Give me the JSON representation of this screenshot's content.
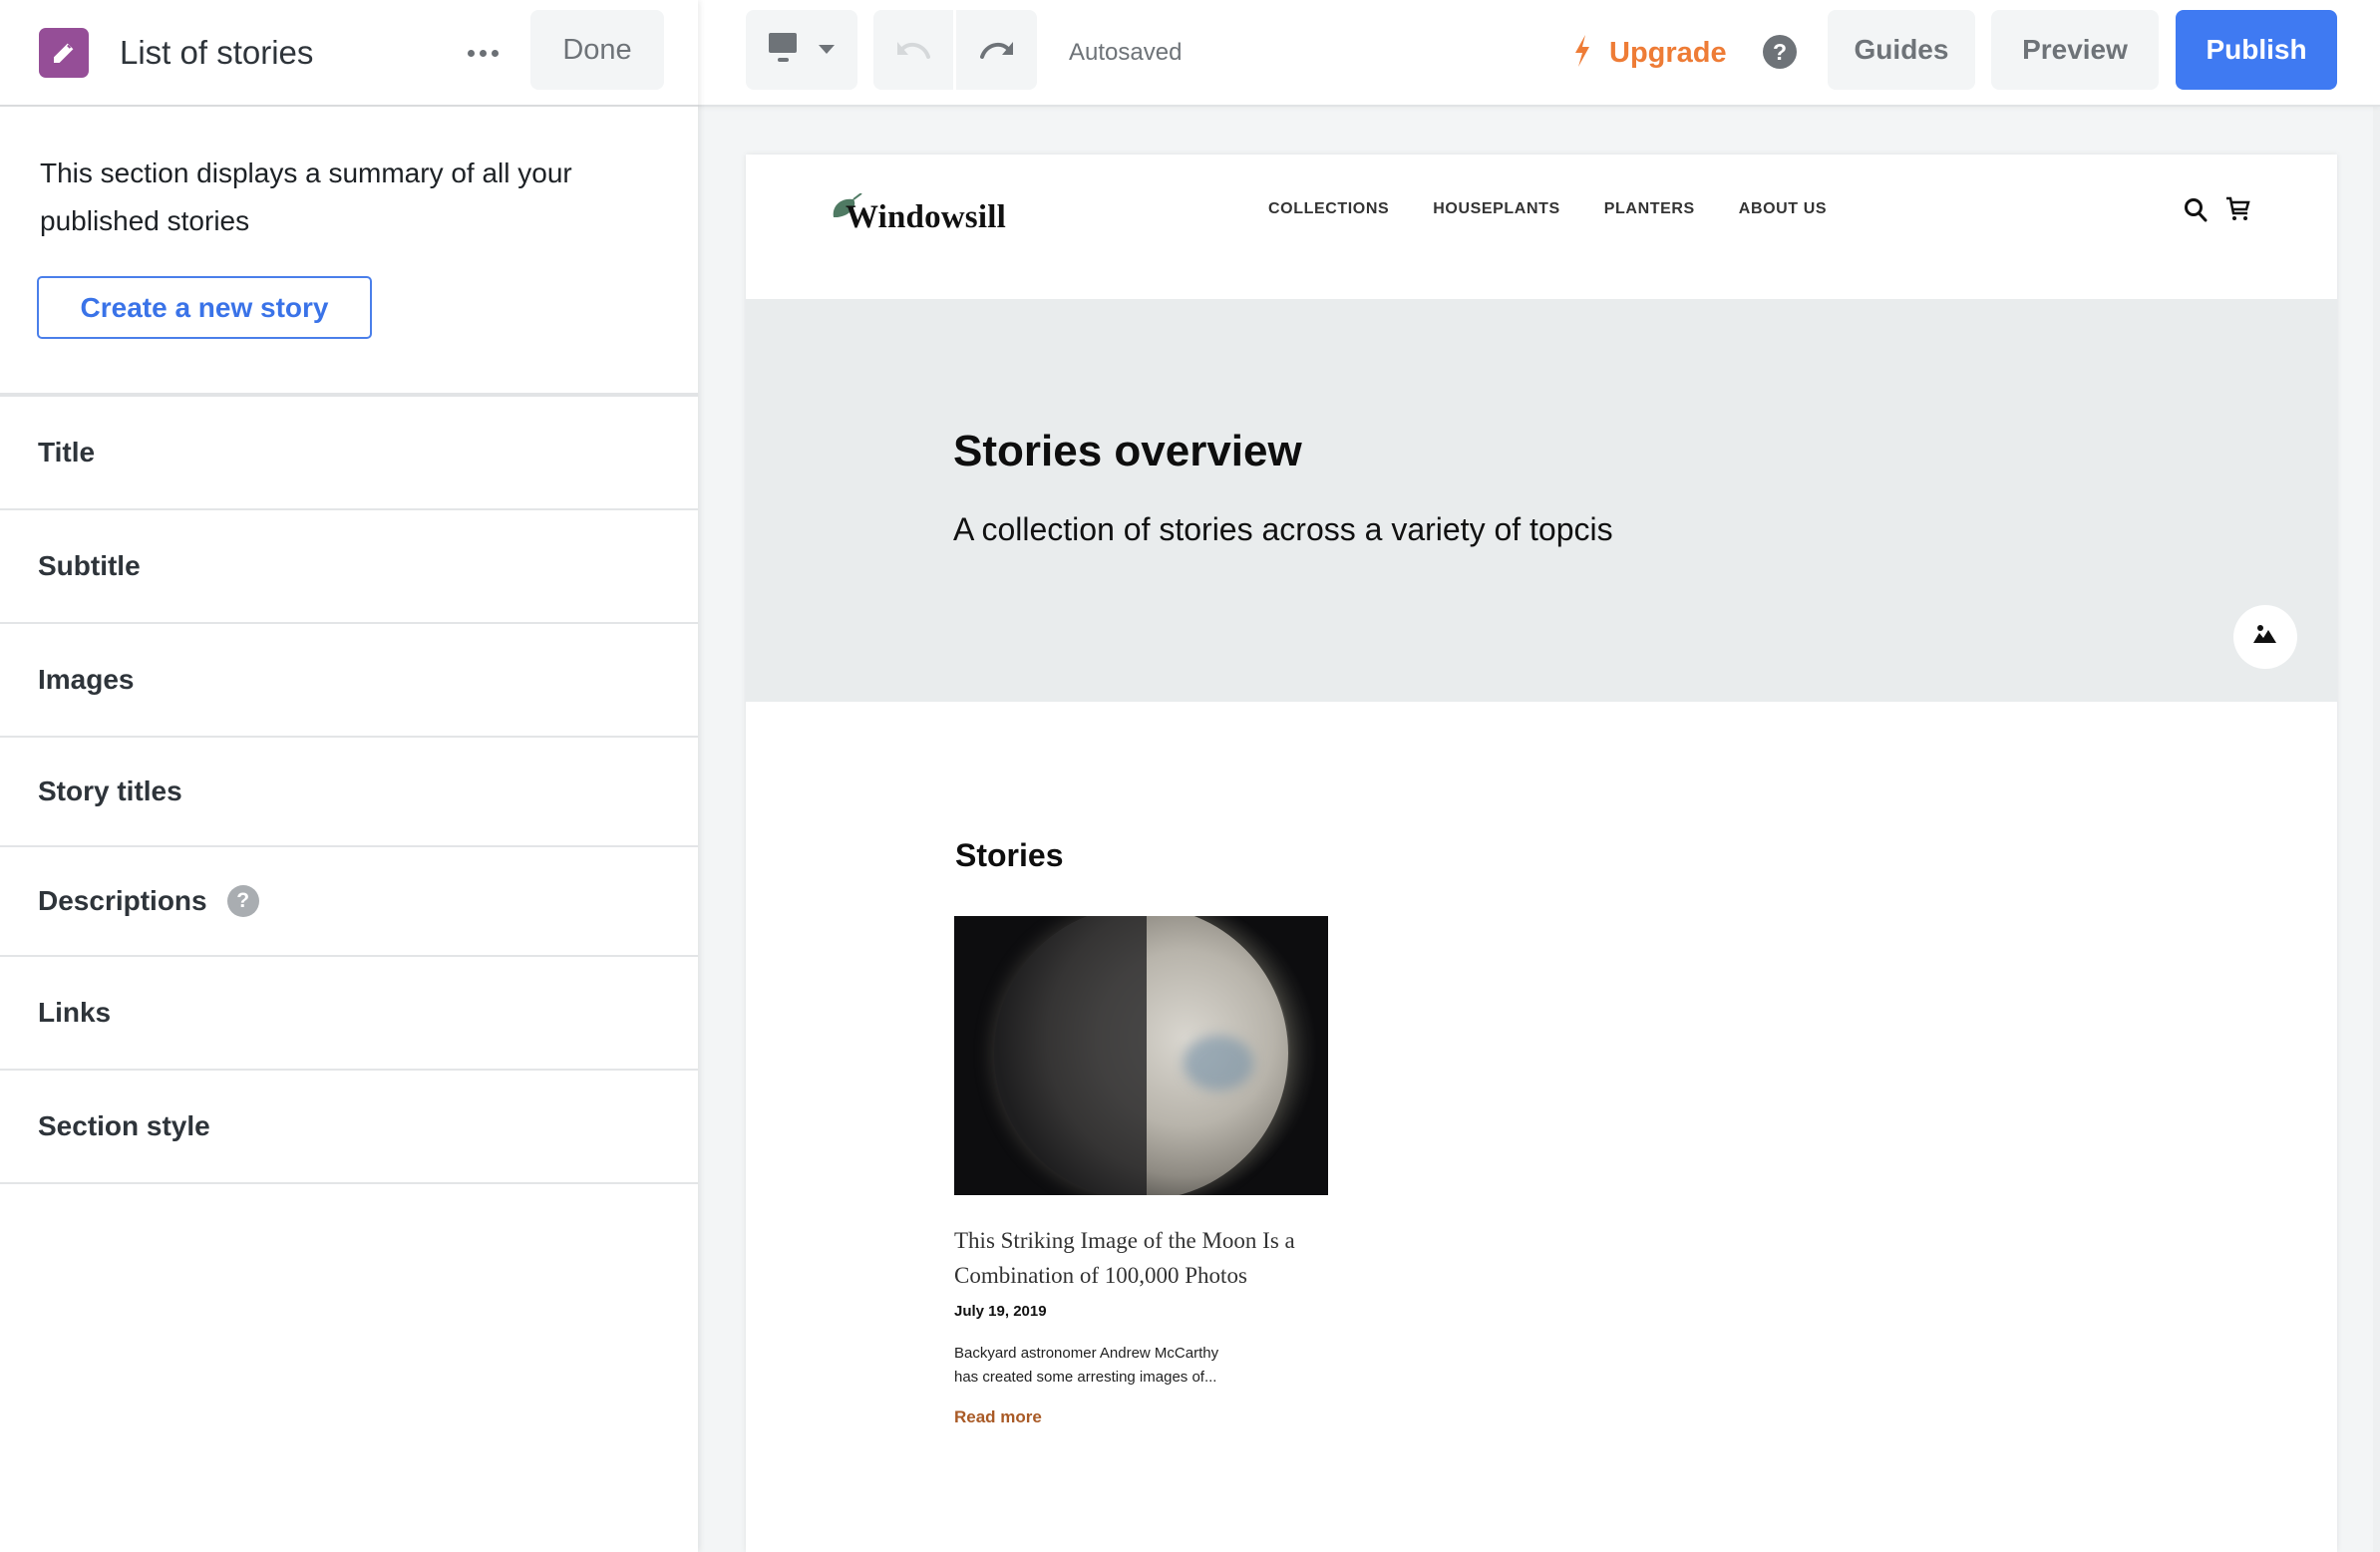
{
  "sidebar": {
    "icon": "pencil-icon",
    "title": "List of stories",
    "more_icon": "ellipsis-icon",
    "done_label": "Done",
    "description": "This section displays a summary of all your published stories",
    "create_label": "Create a new story",
    "items": [
      {
        "label": "Title"
      },
      {
        "label": "Subtitle"
      },
      {
        "label": "Images"
      },
      {
        "label": "Story titles"
      },
      {
        "label": "Descriptions",
        "help": "?"
      },
      {
        "label": "Links"
      },
      {
        "label": "Section style"
      }
    ]
  },
  "toolbar": {
    "device_icon": "desktop-icon",
    "undo_icon": "undo-icon",
    "redo_icon": "redo-icon",
    "status": "Autosaved",
    "upgrade_label": "Upgrade",
    "help_label": "?",
    "guides_label": "Guides",
    "preview_label": "Preview",
    "publish_label": "Publish"
  },
  "colors": {
    "accent": "#3F7AF2",
    "brand_purple": "#954E97",
    "upgrade_orange": "#EE7C36",
    "hero_bg": "#E9ECED",
    "read_more": "#A95A26",
    "logo_leaf": "#4F7A63"
  },
  "site": {
    "logo_text": "Windowsill",
    "nav": [
      "COLLECTIONS",
      "HOUSEPLANTS",
      "PLANTERS",
      "ABOUT US"
    ],
    "hero": {
      "title": "Stories overview",
      "subtitle": "A collection of stories across a variety of topcis"
    },
    "stories_heading": "Stories",
    "stories": [
      {
        "title": "This Striking Image of the Moon Is a Combination of 100,000 Photos",
        "date": "July 19, 2019",
        "description_line1": "Backyard astronomer Andrew McCarthy",
        "description_line2": "has created some arresting images of...",
        "link_label": "Read more"
      }
    ]
  }
}
